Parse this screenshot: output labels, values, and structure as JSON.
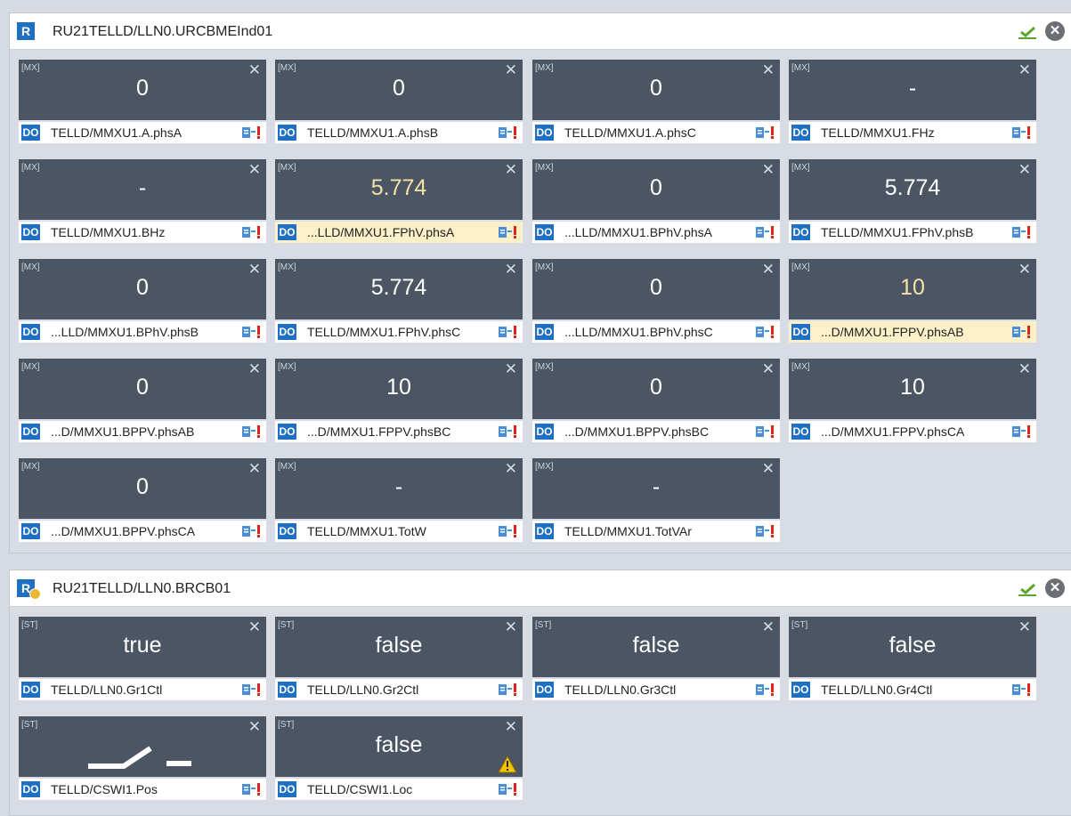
{
  "panels": [
    {
      "badge": "R",
      "title": "RU21TELLD/LLN0.URCBMEInd01",
      "cards": [
        {
          "tag": "[MX]",
          "value": "0",
          "path": "TELLD/MMXU1.A.phsA",
          "highlight": false
        },
        {
          "tag": "[MX]",
          "value": "0",
          "path": "TELLD/MMXU1.A.phsB",
          "highlight": false
        },
        {
          "tag": "[MX]",
          "value": "0",
          "path": "TELLD/MMXU1.A.phsC",
          "highlight": false
        },
        {
          "tag": "[MX]",
          "value": "-",
          "path": "TELLD/MMXU1.FHz",
          "highlight": false
        },
        {
          "tag": "[MX]",
          "value": "-",
          "path": "TELLD/MMXU1.BHz",
          "highlight": false
        },
        {
          "tag": "[MX]",
          "value": "5.774",
          "path": "...LLD/MMXU1.FPhV.phsA",
          "highlight": true
        },
        {
          "tag": "[MX]",
          "value": "0",
          "path": "...LLD/MMXU1.BPhV.phsA",
          "highlight": false
        },
        {
          "tag": "[MX]",
          "value": "5.774",
          "path": "TELLD/MMXU1.FPhV.phsB",
          "highlight": false
        },
        {
          "tag": "[MX]",
          "value": "0",
          "path": "...LLD/MMXU1.BPhV.phsB",
          "highlight": false
        },
        {
          "tag": "[MX]",
          "value": "5.774",
          "path": "TELLD/MMXU1.FPhV.phsC",
          "highlight": false
        },
        {
          "tag": "[MX]",
          "value": "0",
          "path": "...LLD/MMXU1.BPhV.phsC",
          "highlight": false
        },
        {
          "tag": "[MX]",
          "value": "10",
          "path": "...D/MMXU1.FPPV.phsAB",
          "highlight": true
        },
        {
          "tag": "[MX]",
          "value": "0",
          "path": "...D/MMXU1.BPPV.phsAB",
          "highlight": false
        },
        {
          "tag": "[MX]",
          "value": "10",
          "path": "...D/MMXU1.FPPV.phsBC",
          "highlight": false
        },
        {
          "tag": "[MX]",
          "value": "0",
          "path": "...D/MMXU1.BPPV.phsBC",
          "highlight": false
        },
        {
          "tag": "[MX]",
          "value": "10",
          "path": "...D/MMXU1.FPPV.phsCA",
          "highlight": false
        },
        {
          "tag": "[MX]",
          "value": "0",
          "path": "...D/MMXU1.BPPV.phsCA",
          "highlight": false
        },
        {
          "tag": "[MX]",
          "value": "-",
          "path": "TELLD/MMXU1.TotW",
          "highlight": false
        },
        {
          "tag": "[MX]",
          "value": "-",
          "path": "TELLD/MMXU1.TotVAr",
          "highlight": false
        }
      ]
    },
    {
      "badge": "R",
      "title": "RU21TELLD/LLN0.BRCB01",
      "cards": [
        {
          "tag": "[ST]",
          "value": "true",
          "path": "TELLD/LLN0.Gr1Ctl",
          "highlight": false
        },
        {
          "tag": "[ST]",
          "value": "false",
          "path": "TELLD/LLN0.Gr2Ctl",
          "highlight": false
        },
        {
          "tag": "[ST]",
          "value": "false",
          "path": "TELLD/LLN0.Gr3Ctl",
          "highlight": false
        },
        {
          "tag": "[ST]",
          "value": "false",
          "path": "TELLD/LLN0.Gr4Ctl",
          "highlight": false
        },
        {
          "tag": "[ST]",
          "value": "",
          "path": "TELLD/CSWI1.Pos",
          "highlight": false,
          "icon": "switch-open-icon"
        },
        {
          "tag": "[ST]",
          "value": "false",
          "path": "TELLD/CSWI1.Loc",
          "highlight": false,
          "icon": "warning-icon"
        }
      ]
    }
  ],
  "do_badge": "DO",
  "close_glyph": "✕",
  "colors": {
    "card_top": "#4b5563",
    "highlight_bg": "#fbf0c8",
    "badge_blue": "#1f6fc2",
    "check_green": "#5aa62a"
  }
}
